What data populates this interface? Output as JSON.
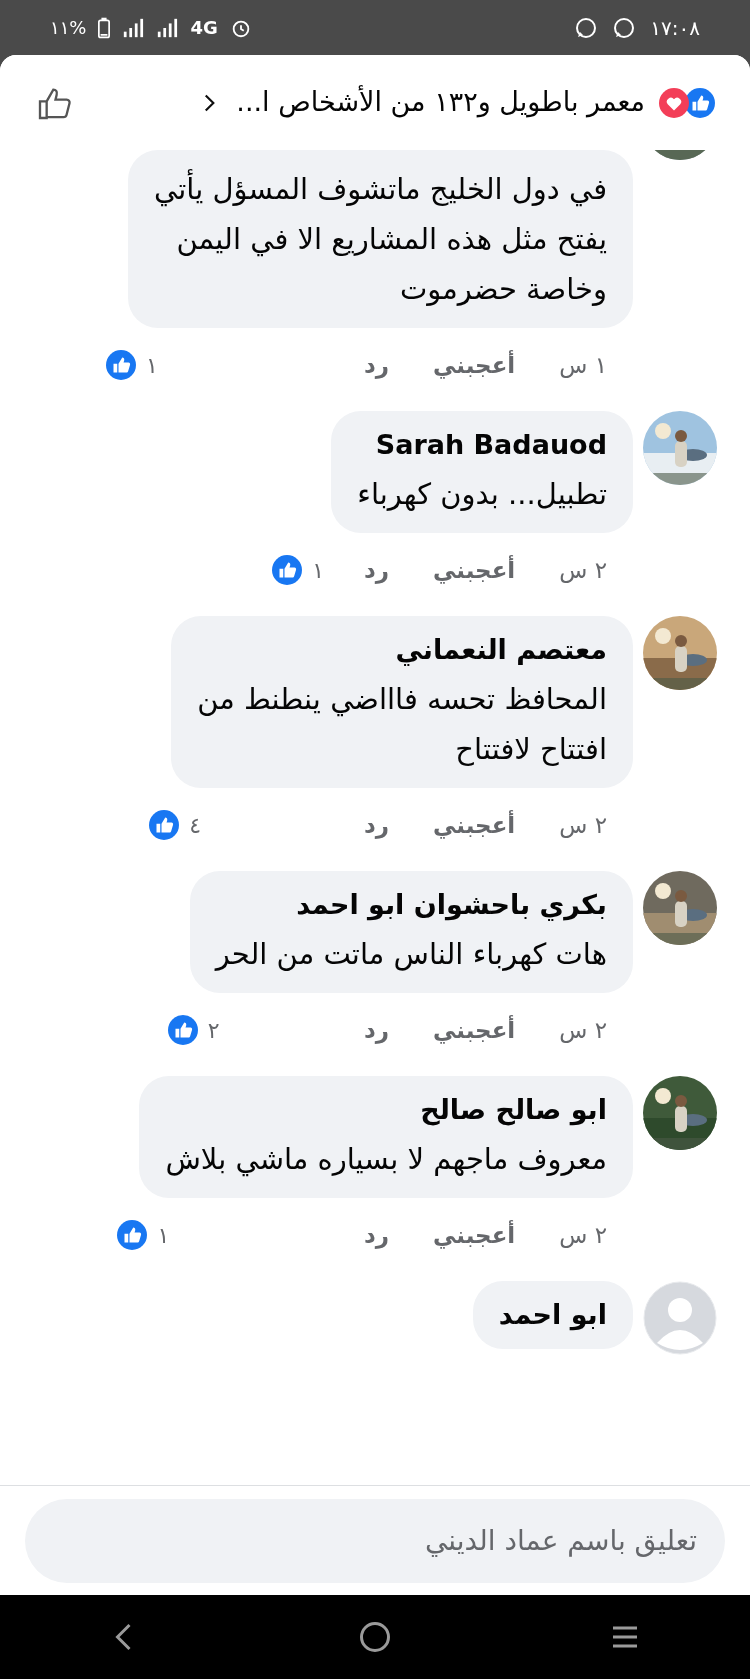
{
  "status_bar": {
    "time": "١٧:٠٨",
    "network": "4G",
    "battery": "%١١"
  },
  "header": {
    "summary": "معمر باطويل و١٣٢ من الأشخاص ا..."
  },
  "comments": [
    {
      "text": "في دول الخليج ماتشوف المسؤل يأتي\nيفتح مثل هذه المشاريع الا في اليمن\nوخاصة حضرموت",
      "time": "١ س",
      "like": "أعجبني",
      "reply": "رد",
      "reactions": "١"
    },
    {
      "name": "Sarah Badauod",
      "text": "تطبيل... بدون كهرباء",
      "time": "٢ س",
      "like": "أعجبني",
      "reply": "رد",
      "reactions": "١"
    },
    {
      "name": "معتصم النعماني",
      "text": "المحافظ تحسه فاااضي ينطنط من\nافتتاح لافتتاح",
      "time": "٢ س",
      "like": "أعجبني",
      "reply": "رد",
      "reactions": "٤"
    },
    {
      "name": "بكري باحشوان ابو احمد",
      "text": "هات كهرباء الناس ماتت من الحر",
      "time": "٢ س",
      "like": "أعجبني",
      "reply": "رد",
      "reactions": "٢"
    },
    {
      "name": "ابو صالح صالح",
      "text": "معروف ماجهم لا بسياره ماشي بلاش",
      "time": "٢ س",
      "like": "أعجبني",
      "reply": "رد",
      "reactions": "١"
    },
    {
      "avatar": {
        "kind": "default"
      },
      "name": "ابو احمد"
    }
  ],
  "composer": {
    "placeholder": "تعليق باسم عماد الديني"
  }
}
